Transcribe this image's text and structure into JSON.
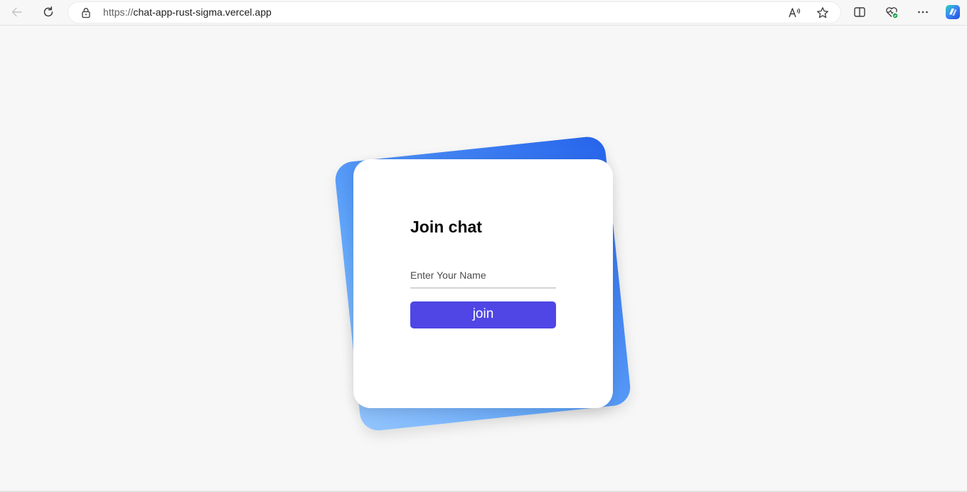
{
  "browser": {
    "url_scheme": "https://",
    "url_host": "chat-app-rust-sigma.vercel.app",
    "icons": {
      "back": "back-arrow-icon",
      "refresh": "refresh-icon",
      "lock": "lock-icon",
      "read_aloud": "read-aloud-icon",
      "favorite": "star-icon",
      "split_screen": "split-screen-icon",
      "browser_essentials": "heart-pulse-icon",
      "more": "more-dots-icon",
      "copilot": "copilot-icon"
    }
  },
  "join_form": {
    "title": "Join chat",
    "name_value": "",
    "name_placeholder": "Enter Your Name",
    "join_label": "join"
  },
  "colors": {
    "button": "#4f46e5",
    "gradient_dark": "#2563eb",
    "gradient_light": "#93c5fd",
    "page_background": "#f7f7f7"
  }
}
